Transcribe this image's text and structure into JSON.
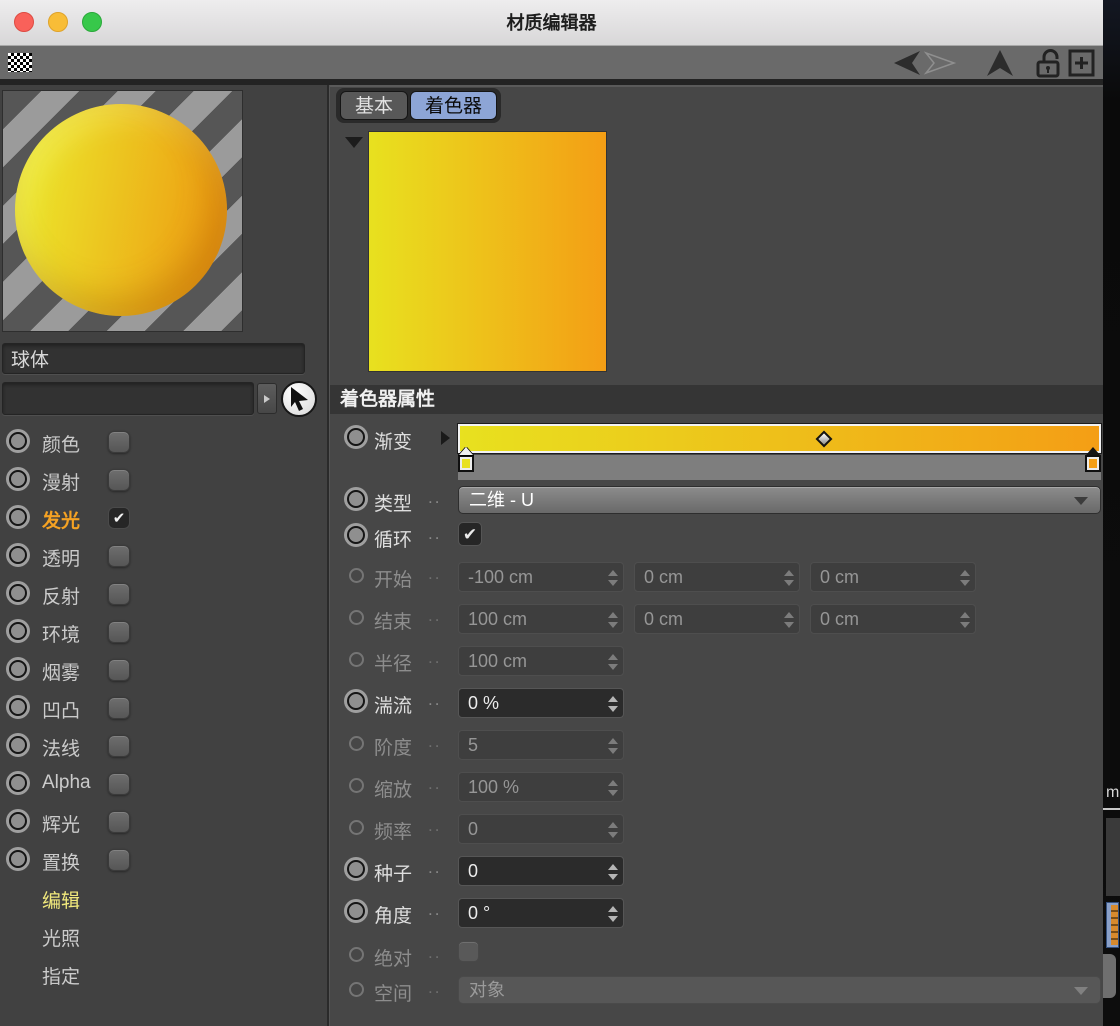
{
  "window_title": "材质编辑器",
  "tabs": [
    {
      "label": "基本",
      "selected": false
    },
    {
      "label": "着色器",
      "selected": true
    }
  ],
  "preview": {
    "material_name": "球体",
    "search_value": ""
  },
  "channels": [
    {
      "key": "color",
      "label": "颜色",
      "checked": false,
      "active": false
    },
    {
      "key": "diffusion",
      "label": "漫射",
      "checked": false,
      "active": false
    },
    {
      "key": "luminance",
      "label": "发光",
      "checked": true,
      "active": true
    },
    {
      "key": "transparency",
      "label": "透明",
      "checked": false,
      "active": false
    },
    {
      "key": "reflectance",
      "label": "反射",
      "checked": false,
      "active": false
    },
    {
      "key": "environment",
      "label": "环境",
      "checked": false,
      "active": false
    },
    {
      "key": "fog",
      "label": "烟雾",
      "checked": false,
      "active": false
    },
    {
      "key": "bump",
      "label": "凹凸",
      "checked": false,
      "active": false
    },
    {
      "key": "normal",
      "label": "法线",
      "checked": false,
      "active": false
    },
    {
      "key": "alpha",
      "label": "Alpha",
      "checked": false,
      "active": false
    },
    {
      "key": "glow",
      "label": "辉光",
      "checked": false,
      "active": false
    },
    {
      "key": "displacement",
      "label": "置换",
      "checked": false,
      "active": false
    }
  ],
  "side_items": [
    {
      "key": "edit",
      "label": "编辑",
      "highlight": true
    },
    {
      "key": "illumination",
      "label": "光照",
      "highlight": false
    },
    {
      "key": "assign",
      "label": "指定",
      "highlight": false
    }
  ],
  "shader_section": {
    "title": "着色器属性"
  },
  "gradient": {
    "midpoint": "57%",
    "knots": [
      {
        "position": "0%",
        "color": "#e8e11f"
      },
      {
        "position": "100%",
        "color": "#f49e15"
      }
    ]
  },
  "properties": [
    {
      "key": "gradient",
      "label": "渐变",
      "type": "gradient",
      "enabled": true
    },
    {
      "key": "type",
      "label": "类型",
      "type": "dropdown",
      "value": "二维 - U",
      "enabled": true
    },
    {
      "key": "cycle",
      "label": "循环",
      "type": "checkbox",
      "checked": true,
      "enabled": true
    },
    {
      "key": "start",
      "label": "开始",
      "type": "inputs",
      "values": [
        "-100 cm",
        "0 cm",
        "0 cm"
      ],
      "enabled": false
    },
    {
      "key": "end",
      "label": "结束",
      "type": "inputs",
      "values": [
        "100 cm",
        "0 cm",
        "0 cm"
      ],
      "enabled": false
    },
    {
      "key": "radius",
      "label": "半径",
      "type": "inputs",
      "values": [
        "100 cm"
      ],
      "enabled": false
    },
    {
      "key": "turbulence",
      "label": "湍流",
      "type": "inputs",
      "values": [
        "0 %"
      ],
      "enabled": true
    },
    {
      "key": "octaves",
      "label": "阶度",
      "type": "inputs",
      "values": [
        "5"
      ],
      "enabled": false
    },
    {
      "key": "scale",
      "label": "缩放",
      "type": "inputs",
      "values": [
        "100 %"
      ],
      "enabled": false
    },
    {
      "key": "frequency",
      "label": "频率",
      "type": "inputs",
      "values": [
        "0"
      ],
      "enabled": false
    },
    {
      "key": "seed",
      "label": "种子",
      "type": "inputs",
      "values": [
        "0"
      ],
      "enabled": true
    },
    {
      "key": "angle",
      "label": "角度",
      "type": "inputs",
      "values": [
        "0 °"
      ],
      "enabled": true
    },
    {
      "key": "absolute",
      "label": "绝对",
      "type": "checkbox",
      "checked": false,
      "enabled": false
    },
    {
      "key": "space",
      "label": "空间",
      "type": "dropdown",
      "value": "对象",
      "enabled": false
    }
  ],
  "colors": {
    "gradient_start": "#e8e11f",
    "gradient_end": "#f49e15",
    "sphere_start": "#ebe32a",
    "sphere_end": "#ee9d12",
    "selected_tab": "#8da5d6",
    "luminance_text": "#f5a223",
    "edit_text": "#f1e97c"
  },
  "edge": {
    "label": "m"
  }
}
